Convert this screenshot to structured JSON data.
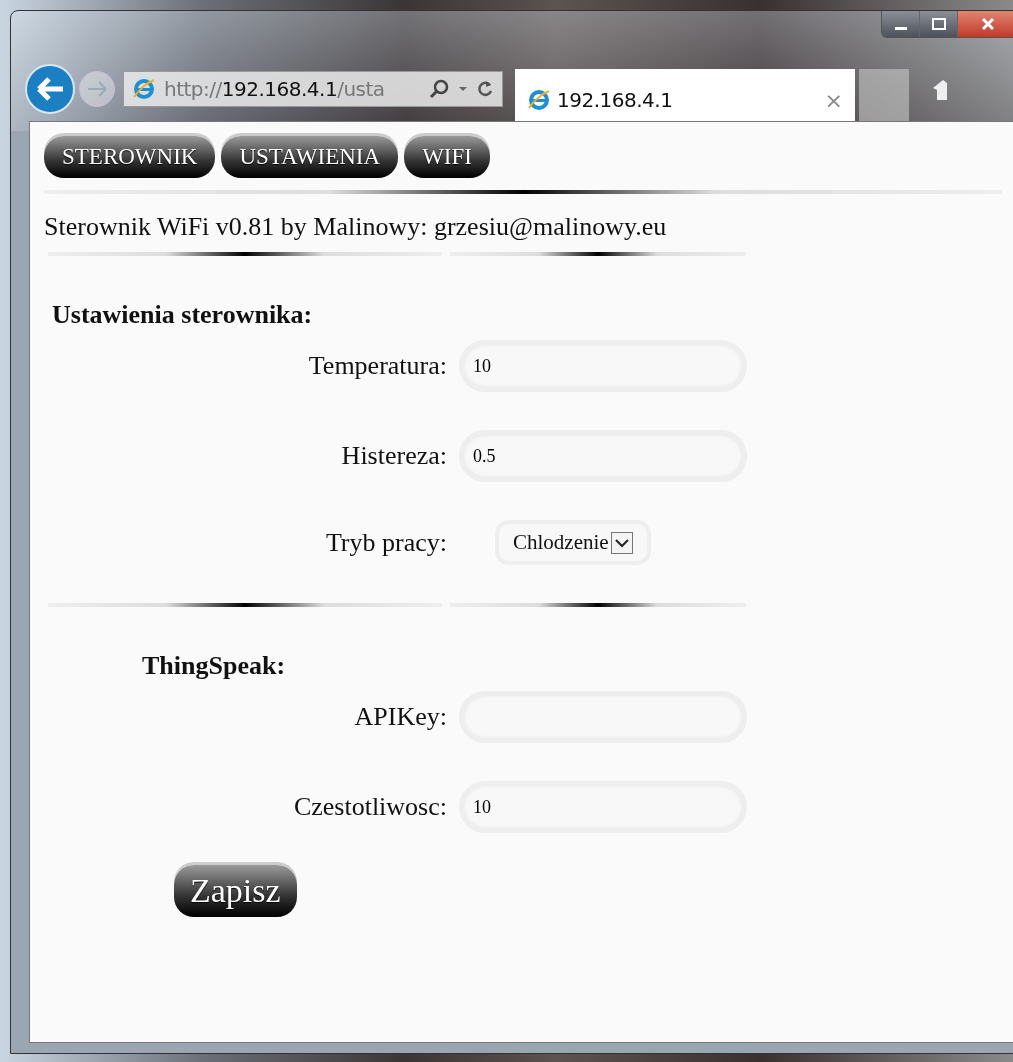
{
  "browser": {
    "address": "http://**192.168.4.1**/usta",
    "tab": {
      "title": "192.168.4.1",
      "close": "×"
    }
  },
  "nav": [
    {
      "label": "STEROWNIK"
    },
    {
      "label": "USTAWIENIA"
    },
    {
      "label": "WIFI"
    }
  ],
  "info": "Sterownik WiFi v0.81 by Malinowy: grzesiu@malinowy.eu",
  "sections": [
    {
      "title": "Ustawienia sterownika:",
      "fields": [
        {
          "kind": "text",
          "label": "Temperatura:",
          "value": "10"
        },
        {
          "kind": "text",
          "label": "Histereza:",
          "value": "0.5"
        },
        {
          "kind": "select",
          "label": "Tryb pracy:",
          "value": "Chlodzenie"
        }
      ]
    },
    {
      "title": "ThingSpeak:",
      "fields": [
        {
          "kind": "text",
          "label": "APIKey:"
        },
        {
          "kind": "text",
          "label": "Czestotliwosc:",
          "value": "10"
        }
      ]
    }
  ],
  "save": "Zapisz"
}
